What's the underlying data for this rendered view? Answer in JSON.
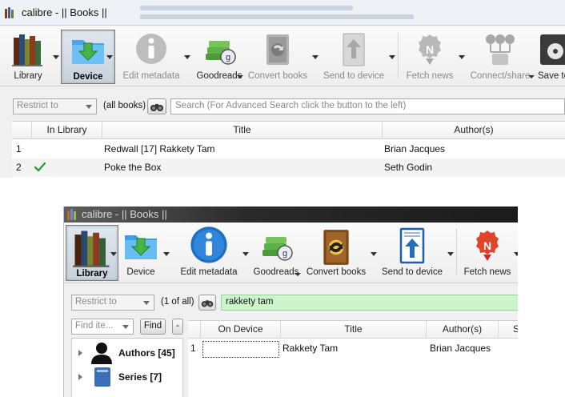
{
  "top_window": {
    "title": "calibre - || Books ||",
    "toolbar": {
      "library": "Library",
      "device": "Device",
      "edit_metadata": "Edit metadata",
      "goodreads": "Goodreads",
      "convert_books": "Convert books",
      "send_to_device": "Send to device",
      "fetch_news": "Fetch news",
      "connect_share": "Connect/share",
      "save_to": "Save to"
    },
    "search": {
      "restrict_to": "Restrict to",
      "book_count": "(all books)",
      "placeholder": "Search (For Advanced Search click the button to the left)"
    },
    "table": {
      "columns": [
        "In Library",
        "Title",
        "Author(s)"
      ],
      "rows": [
        {
          "num": "1",
          "in_library": false,
          "title": "Redwall [17] Rakkety Tam",
          "author": "Brian Jacques"
        },
        {
          "num": "2",
          "in_library": true,
          "title": "Poke the Box",
          "author": "Seth Godin"
        }
      ]
    }
  },
  "bottom_window": {
    "title": "calibre - || Books ||",
    "toolbar": {
      "library": "Library",
      "device": "Device",
      "edit_metadata": "Edit metadata",
      "goodreads": "Goodreads",
      "convert_books": "Convert books",
      "send_to_device": "Send to device",
      "fetch_news": "Fetch news"
    },
    "search": {
      "restrict_to": "Restrict to",
      "book_count": "(1 of all)",
      "query": "rakkety tam"
    },
    "tag_browser": {
      "find_placeholder": "Find ite...",
      "find_button": "Find",
      "collapse_button": "-",
      "items": [
        {
          "label": "Authors",
          "count": "[45]"
        },
        {
          "label": "Series",
          "count": "[7]"
        }
      ]
    },
    "table": {
      "columns": [
        "On Device",
        "Title",
        "Author(s)",
        "S"
      ],
      "rows": [
        {
          "num": "1",
          "title": "Rakkety Tam",
          "author": "Brian Jacques"
        }
      ]
    }
  },
  "colors": {
    "search_match_bg": "#ccf5cc",
    "checkmark": "#2e9e2e",
    "device_icon": "#2e8fd6",
    "fetch_news_icon": "#e0452a"
  }
}
